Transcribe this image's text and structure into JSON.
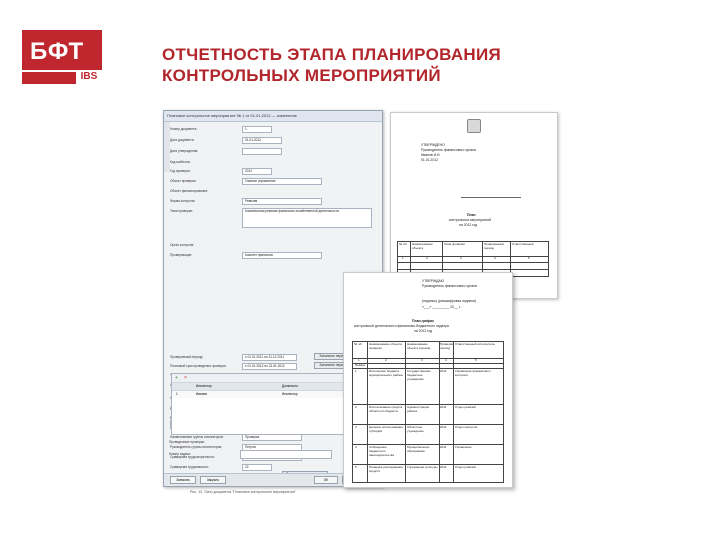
{
  "logo": {
    "text": "БФТ",
    "tag": "IBS",
    "color": "#c0262d"
  },
  "slide": {
    "title_line1": "ОТЧЕТНОСТЬ ЭТАПА ПЛАНИРОВАНИЯ",
    "title_line2": "КОНТРОЛЬНЫХ МЕРОПРИЯТИЙ",
    "accent_color": "#b2252b"
  },
  "form_window": {
    "title": "Плановое контрольное мероприятие № 1 от 01.01.2012 — изменение",
    "fields": [
      {
        "label": "Номер документа:",
        "value": "1"
      },
      {
        "label": "Дата документа:",
        "value": "01.01.2012"
      },
      {
        "label": "Дата утверждения:",
        "value": ""
      },
      {
        "label": "Код шаблона:",
        "value": ""
      },
      {
        "label": "Год проверки:",
        "value": "2012"
      },
      {
        "label": "Объект проверки:",
        "value": "Главное управление"
      },
      {
        "label": "Объект финансирования:",
        "value": ""
      },
      {
        "label": "Форма контроля:",
        "value": "Ревизия"
      },
      {
        "label": "Тема проверки:",
        "value": "Комплексная ревизия финансово-хозяйственной деятельности"
      },
      {
        "label": "Орган контроля:",
        "value": ""
      },
      {
        "label": "Проверяющие:",
        "value": "Комитет финансов"
      },
      {
        "label": "Проверяемый период:",
        "value": "с 01.01.2011 по 31.12.2011"
      },
      {
        "label": "Плановый срок проведения проверки:",
        "value": "с 01.01.2012 по 31.01.2012"
      },
      {
        "label": "Фактический срок:",
        "value": ""
      },
      {
        "label": "Основание (правовой документ):",
        "value": ""
      },
      {
        "label": "Ответственный исполнитель:",
        "value": "Иванов"
      },
      {
        "label": "Должность исполнителя:",
        "value": "Инспектор"
      },
      {
        "label": "Выполнение плана:",
        "value": "нет"
      }
    ],
    "buttons": {
      "select_period": "Заполнить период",
      "fill_period2": "Заполнить период",
      "legal_basis": "Выбрать правовой документ"
    },
    "tabs": [
      "Журнал согласования",
      "Описание проверки"
    ],
    "sub_fields": [
      {
        "label": "Наименование группы инспекторов:",
        "value": "Проверка"
      },
      {
        "label": "Руководитель группы инспекторов:",
        "value": "Петров"
      },
      {
        "label": "Суммарная трудозатратность:",
        "value": "Комплексная"
      },
      {
        "label": "Суммарная трудоемкость:",
        "value": "22"
      }
    ],
    "sub_button": "Рассчитать трудозатраты",
    "grid": {
      "headers": [
        "Инспектор",
        "Должность"
      ],
      "rows": [
        {
          "num": "1",
          "name": "Иванов",
          "role": "Инспектор"
        }
      ]
    },
    "bottom_labels": [
      "Проведенные проверки:",
      "Номер задачи:"
    ],
    "bottom_buttons": [
      "Записать",
      "Закрыть",
      "OK",
      "Отмена"
    ]
  },
  "doc_plan": {
    "header_left": "УТВЕРЖДЕНО",
    "header_lines": [
      "Руководитель финансового органа",
      "Иванов И.И.",
      "01.01.2012"
    ],
    "title": "План",
    "subtitle": "контрольных мероприятий",
    "period": "на 2012 год",
    "columns": [
      "№ п/п",
      "Наименование объекта",
      "Тема проверки",
      "Проверяемый период",
      "Ответственный"
    ],
    "col_nums": [
      "1",
      "2",
      "3",
      "4",
      "5"
    ]
  },
  "doc_schedule": {
    "approve": "УТВЕРЖДАЮ",
    "approve_lines": [
      "Руководитель финансового органа",
      "(подпись) (расшифровка подписи)",
      "«___» _________ 20__ г."
    ],
    "title": "План-график",
    "subtitle": "контрольной деятельности финансово-бюджетного надзора",
    "period": "на 2012 год",
    "columns": [
      "№ п/п",
      "Наименование объекта проверки",
      "Наименование объекта (органа)",
      "Проверяемый период",
      "Ответственный исполнитель"
    ],
    "col_nums": [
      "1",
      "2",
      "3",
      "4",
      "5"
    ],
    "section": "Январь",
    "rows": [
      {
        "num": "1",
        "c2": "Исполнение бюджета муниципального района",
        "c3": "Государственное бюджетное учреждение",
        "c4": "2011",
        "c5": "Управление финансового контроля"
      },
      {
        "num": "2",
        "c2": "Использование средств областного бюджета",
        "c3": "Администрация района",
        "c4": "2011",
        "c5": "Отдел ревизий"
      },
      {
        "num": "3",
        "c2": "Целевое использование субсидий",
        "c3": "Областное учреждение",
        "c4": "2011",
        "c5": "Отдел контроля"
      },
      {
        "num": "4",
        "c2": "Соблюдение бюджетного законодательства",
        "c3": "Муниципальное образование",
        "c4": "2011",
        "c5": "Управление"
      },
      {
        "num": "5",
        "c2": "Проверка расходования средств",
        "c3": "Учреждение культуры",
        "c4": "2011",
        "c5": "Отдел ревизий"
      }
    ]
  },
  "caption": "Рис. 12. Окно документа \"Плановое контрольное мероприятие\""
}
